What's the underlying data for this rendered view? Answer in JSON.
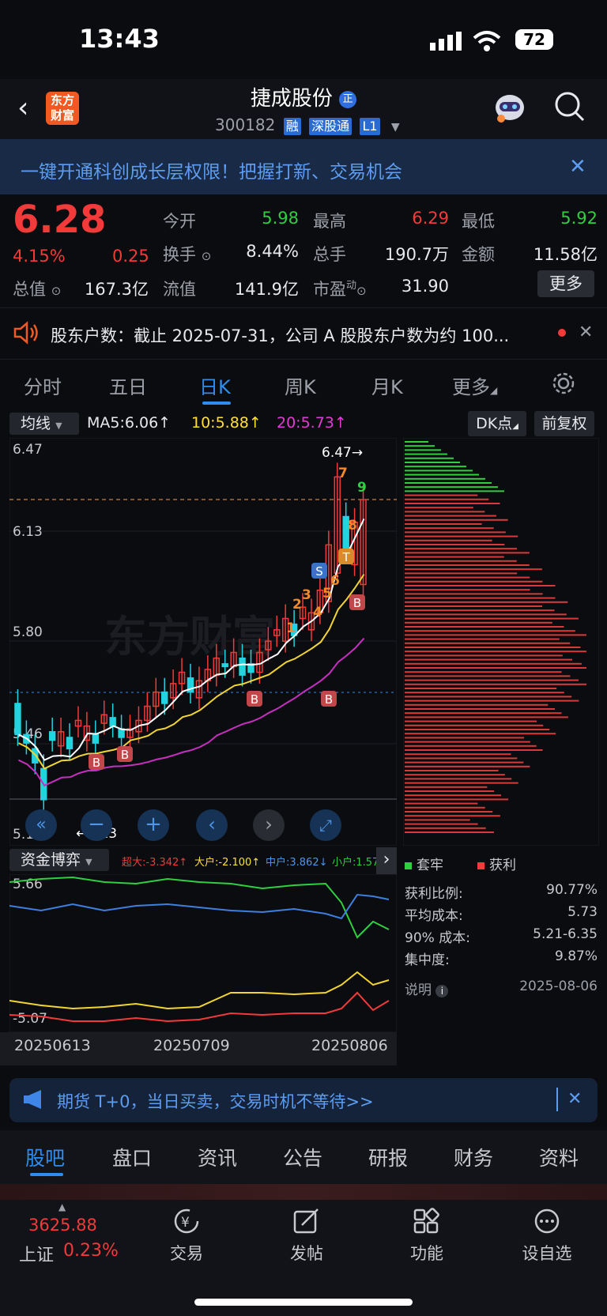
{
  "status_bar": {
    "time": "13:43",
    "battery": "72"
  },
  "header": {
    "title": "捷成股份",
    "title_badge": "正",
    "logo_text": "东方财富",
    "code": "300182",
    "tags": [
      "融",
      "深股通",
      "L1"
    ]
  },
  "banner": {
    "text": "一键开通科创成长层权限！把握打新、交易机会"
  },
  "quote": {
    "price": "6.28",
    "change_pct": "4.15%",
    "change": "0.25",
    "fields": [
      {
        "label": "今开",
        "value": "5.98"
      },
      {
        "label": "最高",
        "value": "6.29"
      },
      {
        "label": "最低",
        "value": "5.92"
      },
      {
        "label": "换手",
        "value": "8.44%"
      },
      {
        "label": "总手",
        "value": "190.7万"
      },
      {
        "label": "金额",
        "value": "11.58亿"
      },
      {
        "label": "总值",
        "value": "167.3亿"
      },
      {
        "label": "流值",
        "value": "141.9亿"
      },
      {
        "label": "市盈",
        "label_sup": "动",
        "value": "31.90"
      }
    ],
    "more_button": "更多"
  },
  "notice": {
    "text": "股东户数：截止 2025-07-31，公司 A 股股东户数为约 100..."
  },
  "chart_tabs": [
    "分时",
    "五日",
    "日K",
    "周K",
    "月K",
    "更多"
  ],
  "chart_tab_active": 2,
  "ma_bar": {
    "selector": "均线",
    "ma5": "MA5:6.06↑",
    "ma10": "10:5.88↑",
    "ma20": "20:5.73↑",
    "dk": "DK点",
    "adjust": "前复权"
  },
  "price_axis": {
    "max_label": "6.47",
    "l2": "6.13",
    "l3": "5.80",
    "l4": "5.46",
    "min_label": "5.13",
    "high_marker": "6.47→",
    "low_marker": "←5.13"
  },
  "markers": {
    "b": "B",
    "s": "S",
    "t": "T",
    "seq": [
      "1",
      "2",
      "3",
      "4",
      "5",
      "6",
      "7",
      "8",
      "9"
    ]
  },
  "watermark": "东方财富",
  "funds": {
    "selector": "资金博弈",
    "super": "超大:-3.342↑",
    "big": "大户:-2.100↑",
    "mid": "中户:3.862↓",
    "small": "小户:1.579",
    "max": "5.66",
    "min": "-5.07"
  },
  "dates": [
    "20250613",
    "20250709",
    "20250806"
  ],
  "chip": {
    "legend_trapped": "套牢",
    "legend_profit": "获利",
    "stats": [
      {
        "label": "获利比例:",
        "value": "90.77%"
      },
      {
        "label": "平均成本:",
        "value": "5.73"
      },
      {
        "label": "90% 成本:",
        "value": "5.21-6.35"
      },
      {
        "label": "集中度:",
        "value": "9.87%"
      }
    ],
    "note": "说明",
    "date": "2025-08-06"
  },
  "ad": {
    "text": "期货 T+0，当日买卖，交易时机不等待>>"
  },
  "bottom_tabs": [
    "股吧",
    "盘口",
    "资讯",
    "公告",
    "研报",
    "财务",
    "资料"
  ],
  "nav": {
    "index_value": "3625.88",
    "index_name": "上证",
    "index_change": "0.23%",
    "items": [
      "交易",
      "发帖",
      "功能",
      "设自选"
    ]
  },
  "colors": {
    "up": "#f23a3a",
    "down": "#2fcf3f",
    "accent": "#2f8cf0",
    "candle_down": "#22d3e0"
  },
  "chart_data": {
    "type": "candlestick",
    "ylim": [
      5.13,
      6.47
    ],
    "x_labels": [
      "20250613",
      "20250709",
      "20250806"
    ],
    "ma_values": {
      "MA5": 6.06,
      "MA10": 5.88,
      "MA20": 5.73
    },
    "last_close": 6.28
  }
}
